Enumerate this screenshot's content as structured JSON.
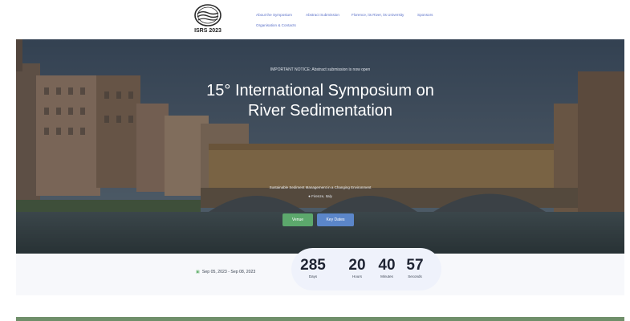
{
  "logo": {
    "text": "ISRS 2023"
  },
  "nav": {
    "items": [
      {
        "label": "About the Symposium"
      },
      {
        "label": "Abstract Submission"
      },
      {
        "label": "Florence, its River, its University"
      },
      {
        "label": "Sponsors"
      },
      {
        "label": "Organisation & Contacts"
      }
    ]
  },
  "hero": {
    "notice": "IMPORTANT NOTICE: Abstract submission is now open",
    "title": "15° International Symposium on River Sedimentation",
    "theme": "Sustainable Sediment Management in a Changing Environment",
    "location": "Firenze, Italy",
    "buttons": {
      "venue": "Venue",
      "key_dates": "Key Dates"
    }
  },
  "event": {
    "date_range": "Sep 05, 2023 - Sep 08, 2023"
  },
  "countdown": [
    {
      "value": "285",
      "label": "Days"
    },
    {
      "value": "20",
      "label": "Hours"
    },
    {
      "value": "40",
      "label": "Minutes"
    },
    {
      "value": "57",
      "label": "Seconds"
    }
  ],
  "icons": {
    "location": "map-pin-icon",
    "calendar": "calendar-icon"
  },
  "colors": {
    "accent_green": "#5ca86c",
    "accent_blue": "#5b86c9",
    "nav_link": "#5a70c8"
  }
}
